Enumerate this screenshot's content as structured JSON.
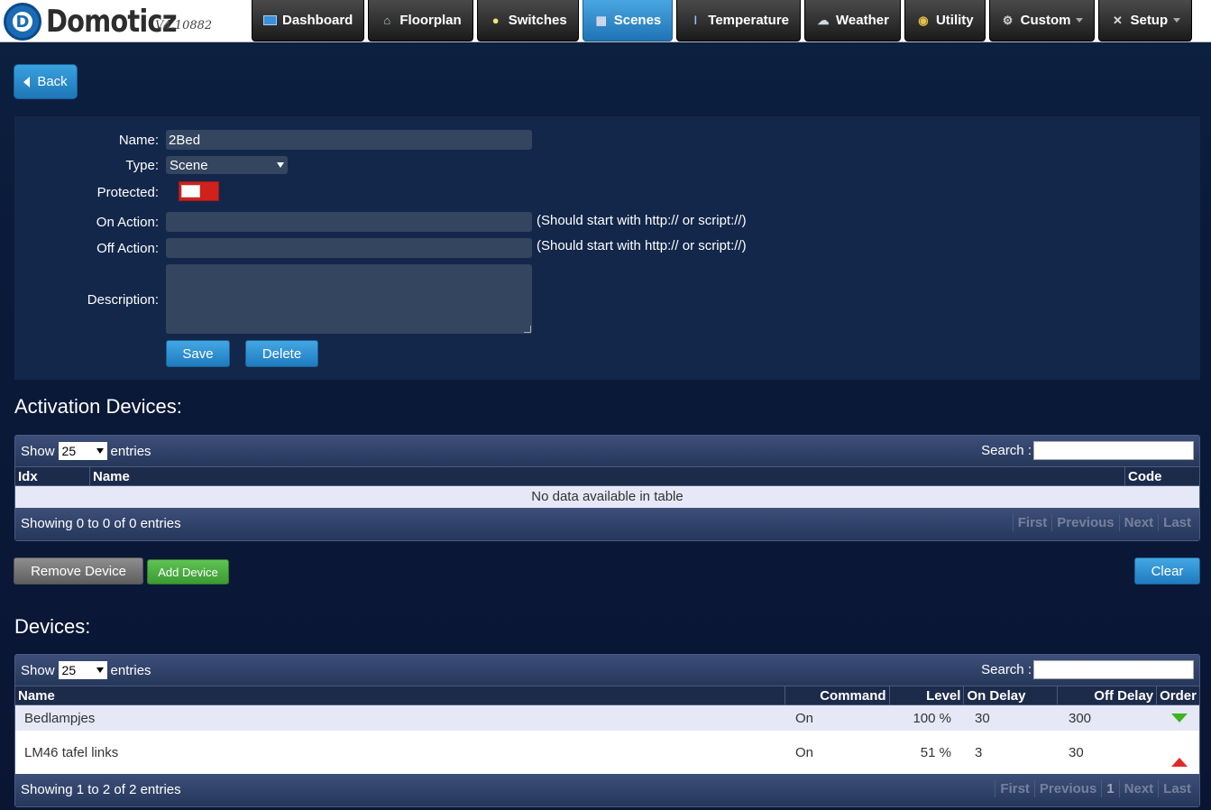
{
  "app": {
    "name": "Domoticz",
    "version": "V4.10882",
    "logo_letter": "D"
  },
  "nav": [
    {
      "label": "Dashboard",
      "icon": "dashboard-icon",
      "active": false
    },
    {
      "label": "Floorplan",
      "icon": "floorplan-icon",
      "active": false
    },
    {
      "label": "Switches",
      "icon": "lightbulb-icon",
      "active": false
    },
    {
      "label": "Scenes",
      "icon": "clapperboard-icon",
      "active": true
    },
    {
      "label": "Temperature",
      "icon": "thermometer-icon",
      "active": false
    },
    {
      "label": "Weather",
      "icon": "weather-cloud-icon",
      "active": false
    },
    {
      "label": "Utility",
      "icon": "utility-icon",
      "active": false
    },
    {
      "label": "Custom",
      "icon": "gear-icon",
      "active": false,
      "dropdown": true
    },
    {
      "label": "Setup",
      "icon": "tools-icon",
      "active": false,
      "dropdown": true
    }
  ],
  "back_label": "Back",
  "form": {
    "name_label": "Name:",
    "name_value": "2Bed",
    "type_label": "Type:",
    "type_value": "Scene",
    "protected_label": "Protected:",
    "protected_on": false,
    "on_action_label": "On Action:",
    "on_action_value": "",
    "on_action_hint": "(Should start with http:// or script://)",
    "off_action_label": "Off Action:",
    "off_action_value": "",
    "off_action_hint": "(Should start with http:// or script://)",
    "description_label": "Description:",
    "description_value": "",
    "save_label": "Save",
    "delete_label": "Delete"
  },
  "activation": {
    "title": "Activation Devices:",
    "show_label": "Show",
    "entries_label": "entries",
    "length_value": "25",
    "search_label": "Search :",
    "columns": [
      "Idx",
      "Name",
      "Code"
    ],
    "empty_text": "No data available in table",
    "info": "Showing 0 to 0 of 0 entries",
    "pager": [
      "First",
      "Previous",
      "Next",
      "Last"
    ]
  },
  "actions": {
    "remove_label": "Remove Device",
    "add_label": "Add Device",
    "clear_label": "Clear"
  },
  "devices": {
    "title": "Devices:",
    "show_label": "Show",
    "entries_label": "entries",
    "length_value": "25",
    "search_label": "Search :",
    "columns": [
      "Name",
      "Command",
      "Level",
      "On Delay",
      "Off Delay",
      "Order"
    ],
    "rows": [
      {
        "name": "Bedlampjes",
        "command": "On",
        "level": "100 %",
        "on_delay": "30",
        "off_delay": "300",
        "order": "down"
      },
      {
        "name": "LM46 tafel links",
        "command": "On",
        "level": "51 %",
        "on_delay": "3",
        "off_delay": "30",
        "order": "up"
      }
    ],
    "info": "Showing 1 to 2 of 2 entries",
    "pager": [
      "First",
      "Previous",
      "1",
      "Next",
      "Last"
    ]
  }
}
